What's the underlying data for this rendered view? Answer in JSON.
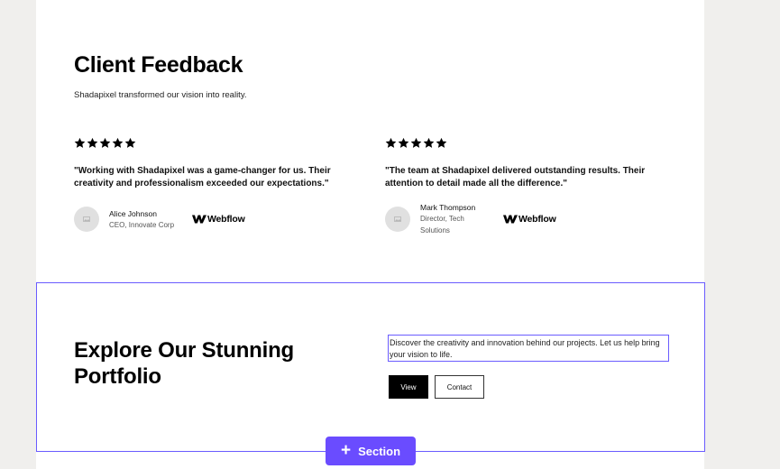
{
  "feedback": {
    "title": "Client Feedback",
    "subtitle": "Shadapixel transformed our vision into reality.",
    "testimonials": [
      {
        "rating": 5,
        "quote": "\"Working with Shadapixel was a game-changer for us. Their creativity and professionalism exceeded our expectations.\"",
        "name": "Alice Johnson",
        "role": "CEO, Innovate Corp",
        "brand": "Webflow"
      },
      {
        "rating": 5,
        "quote": "\"The team at Shadapixel delivered outstanding results. Their attention to detail made all the difference.\"",
        "name": "Mark Thompson",
        "role": "Director, Tech Solutions",
        "brand": "Webflow"
      }
    ]
  },
  "portfolio": {
    "title": "Explore Our Stunning Portfolio",
    "description": "Discover the creativity and innovation behind our projects. Let us help bring your vision to life.",
    "view_label": "View",
    "contact_label": "Contact"
  },
  "editor": {
    "add_section_label": "Section",
    "accent_color": "#6a4cff"
  },
  "icons": {
    "star": "star-icon",
    "avatar": "image-placeholder-icon",
    "brand": "webflow-logo-icon",
    "add": "plus-icon"
  }
}
